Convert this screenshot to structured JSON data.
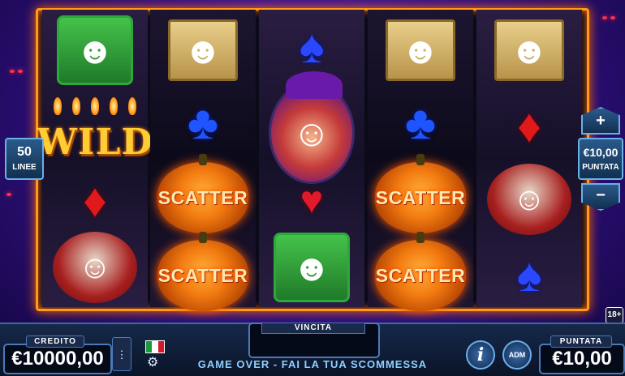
{
  "reels": [
    [
      "frankenstein",
      "wild",
      "diamond",
      "vampire"
    ],
    [
      "mummy",
      "club",
      "scatter",
      "scatter"
    ],
    [
      "spade",
      "witch",
      "heart",
      "frankenstein"
    ],
    [
      "mummy",
      "club",
      "scatter",
      "scatter"
    ],
    [
      "mummy",
      "diamond",
      "vampire",
      "spade"
    ]
  ],
  "symbols": {
    "wild_label": "WILD",
    "scatter_label": "SCATTER"
  },
  "lines": {
    "value": "50",
    "label": "LINEE"
  },
  "bet_control": {
    "value": "€10,00",
    "label": "PUNTATA",
    "plus": "+",
    "minus": "−"
  },
  "age_badge": "18+",
  "credit": {
    "label": "CREDITO",
    "value": "€10000,00"
  },
  "win": {
    "label": "VINCITA",
    "value": ""
  },
  "status_message": "GAME OVER - FAI LA TUA SCOMMESSA",
  "bet_display": {
    "label": "PUNTATA",
    "value": "€10,00"
  },
  "buttons": {
    "info": "i",
    "adm": "ADM"
  },
  "colors": {
    "frame": "#ff9a1a",
    "background": "#32118a",
    "panel_border": "#4a7ab8"
  },
  "icons": [
    "menu-icon",
    "italy-flag-icon",
    "settings-gear-icon",
    "info-icon",
    "adm-logo-icon"
  ]
}
